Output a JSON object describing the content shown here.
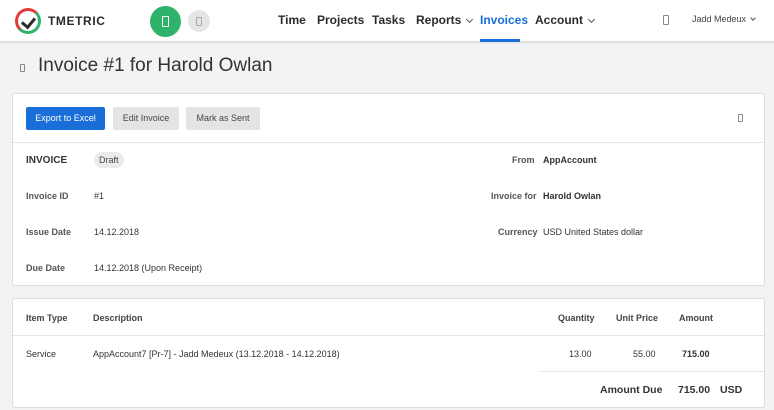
{
  "header": {
    "brand": "TMETRIC",
    "nav": [
      {
        "label": "Time"
      },
      {
        "label": "Projects"
      },
      {
        "label": "Tasks"
      },
      {
        "label": "Reports"
      },
      {
        "label": "Invoices"
      },
      {
        "label": "Account"
      }
    ],
    "active_nav": "Invoices",
    "user": "Jadd Medeux"
  },
  "page": {
    "title": "Invoice #1 for Harold Owlan"
  },
  "toolbar": {
    "export_label": "Export to Excel",
    "edit_label": "Edit Invoice",
    "sent_label": "Mark as Sent"
  },
  "invoice": {
    "heading": "INVOICE",
    "status": "Draft",
    "id_label": "Invoice ID",
    "id": "#1",
    "issue_label": "Issue Date",
    "issue": "14.12.2018",
    "due_label": "Due Date",
    "due": "14.12.2018 (Upon Receipt)",
    "from_label": "From",
    "from": "AppAccount",
    "for_label": "Invoice for",
    "for": "Harold Owlan",
    "currency_label": "Currency",
    "currency": "USD United States dollar"
  },
  "items": {
    "columns": [
      "Item Type",
      "Description",
      "Quantity",
      "Unit Price",
      "Amount"
    ],
    "rows": [
      {
        "type": "Service",
        "description": "AppAccount7 [Pr-7] - Jadd Medeux (13.12.2018 - 14.12.2018)",
        "quantity": "13.00",
        "unit_price": "55.00",
        "amount": "715.00"
      }
    ],
    "amount_due_label": "Amount Due",
    "amount_due": "715.00",
    "currency": "USD"
  },
  "colors": {
    "accent": "#1a6ed8",
    "timer_green": "#2fb36b"
  }
}
